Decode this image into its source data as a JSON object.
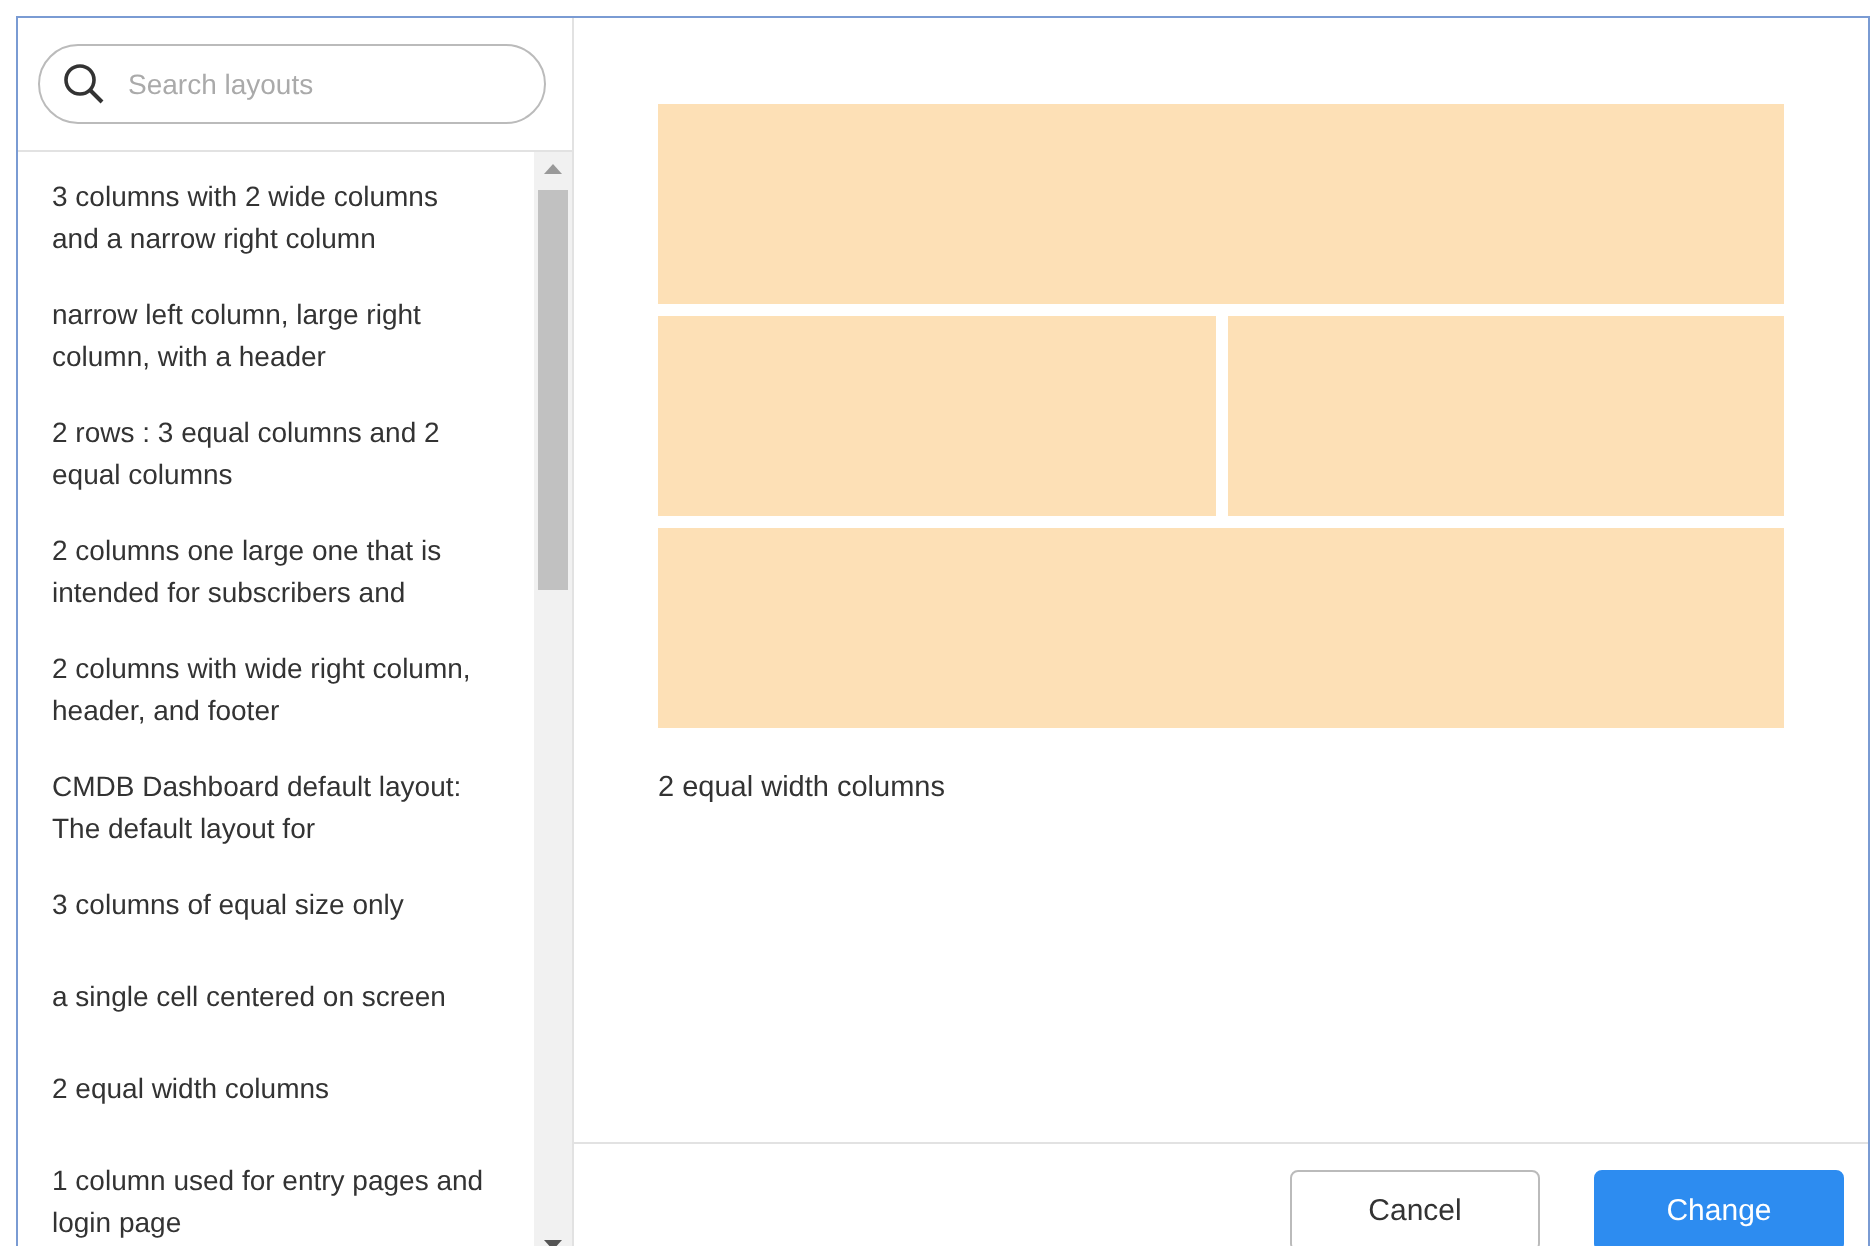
{
  "search": {
    "placeholder": "Search layouts"
  },
  "layouts": [
    {
      "label": "3 columns with 2 wide columns and a narrow right column"
    },
    {
      "label": "narrow left column, large right column, with a header"
    },
    {
      "label": "2 rows : 3 equal columns and 2 equal columns"
    },
    {
      "label": "2 columns one large one that is intended for subscribers and"
    },
    {
      "label": "2 columns with wide right column, header, and footer"
    },
    {
      "label": "CMDB Dashboard default layout: The default layout for"
    },
    {
      "label": "3 columns of equal size only"
    },
    {
      "label": "a single cell centered on screen"
    },
    {
      "label": "2 equal width columns"
    },
    {
      "label": "1 column used for entry pages and login page"
    }
  ],
  "preview": {
    "caption": "2 equal width columns"
  },
  "buttons": [
    {
      "label": "Cancel",
      "kind": "secondary"
    },
    {
      "label": "Change",
      "kind": "primary"
    }
  ]
}
